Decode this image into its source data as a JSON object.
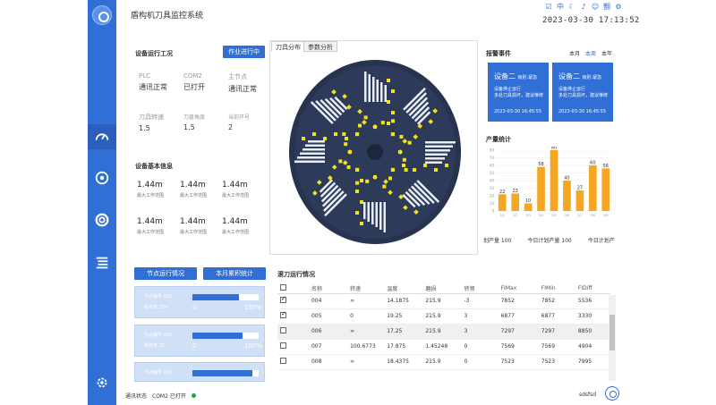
{
  "app": {
    "title": "盾构机刀具监控系统",
    "datetime": "2023-03-30  17:13:52",
    "user": "sdsfsd"
  },
  "topbar": {
    "icons": [
      "checkbox-icon",
      "lang-icon",
      "moon-icon",
      "notes-icon",
      "smiley-icon",
      "tree-icon",
      "gear-icon"
    ],
    "glyphs": [
      "☑",
      "中",
      "☾",
      "♪",
      "☺",
      "䎖",
      "⚙"
    ]
  },
  "sidebar": {
    "items": [
      "dashboard-icon",
      "cutter-icon",
      "lifebuoy-icon",
      "menu-icon",
      "settings-icon"
    ]
  },
  "run_status": {
    "title": "设备运行工况",
    "button": "作业进行中",
    "params": [
      {
        "label": "PLC",
        "value": "通讯正常"
      },
      {
        "label": "COM2",
        "value": "已打开"
      },
      {
        "label": "主节点",
        "value": "通讯正常"
      },
      {
        "label": "刀具转速",
        "value": "1.5"
      },
      {
        "label": "刀盘角度",
        "value": "1.5"
      },
      {
        "label": "当前环号",
        "value": "2"
      }
    ]
  },
  "basic_info": {
    "title": "设备基本信息",
    "items": [
      {
        "value": "1.44m",
        "label": "最大工作范围"
      },
      {
        "value": "1.44m",
        "label": "最大工作范围"
      },
      {
        "value": "1.44m",
        "label": "最大工作范围"
      },
      {
        "value": "1.44m",
        "label": "最大工作范围"
      },
      {
        "value": "1.44m",
        "label": "最大工作范围"
      },
      {
        "value": "1.44m",
        "label": "最大工作范围"
      }
    ]
  },
  "node_panel": {
    "button1": "节点运行情况",
    "button2": "本月累积统计",
    "cards": [
      {
        "l1": "节点编号  001",
        "l2": "损坏率  224",
        "fill": 0.7,
        "min": "0",
        "max": "100%"
      },
      {
        "l1": "节点编号  002",
        "l2": "损坏率  22",
        "fill": 0.75,
        "min": "0",
        "max": "100%"
      },
      {
        "l1": "节点编号  003",
        "l2": "",
        "fill": 0.9,
        "min": "0",
        "max": "100%"
      }
    ]
  },
  "cutter": {
    "tabs": [
      "刀具分布",
      "参数分析"
    ]
  },
  "events": {
    "title": "报警事件",
    "tabs": [
      "本月",
      "本周",
      "本年"
    ],
    "active_tab": "本周",
    "cards": [
      {
        "title": "设备二",
        "sub": "级别:紧急",
        "desc1": "设备停止运行",
        "desc2": "多处刀具损坏，建议维修",
        "time": "2023-03-30 16:45:55"
      },
      {
        "title": "设备二",
        "sub": "级别:紧急",
        "desc1": "设备停止运行",
        "desc2": "多处刀具损坏，建议维修",
        "time": "2023-03-30 16:45:55"
      }
    ]
  },
  "output": {
    "title": "产量统计",
    "stats": [
      "划产量 100",
      "今日计划产量 100",
      "今日计划产"
    ]
  },
  "chart_data": {
    "type": "bar",
    "title": "产量统计",
    "categories": [
      "3/1",
      "3/2",
      "3/3",
      "3/4",
      "3/5",
      "3/6",
      "3/7",
      "3/8",
      "3/9"
    ],
    "values": [
      22,
      23,
      10,
      58,
      80,
      40,
      27,
      60,
      56
    ],
    "ylim": [
      0,
      80
    ],
    "yticks": [
      0,
      10,
      20,
      30,
      40,
      50,
      60,
      70,
      80
    ],
    "color": "#f5a623"
  },
  "table": {
    "title": "滚刀运行情况",
    "columns": [
      "",
      "名称",
      "转速",
      "温度",
      "磨损",
      "转频",
      "FIMax",
      "FIMin",
      "FIDiff"
    ],
    "rows": [
      {
        "checked": true,
        "cells": [
          "004",
          "∞",
          "14.1875",
          "215.9",
          "-3",
          "7852",
          "7852",
          "5536"
        ]
      },
      {
        "checked": true,
        "cells": [
          "005",
          "0",
          "19.25",
          "215.9",
          "3",
          "6877",
          "6877",
          "3330"
        ]
      },
      {
        "checked": false,
        "cells": [
          "006",
          "∞",
          "17.25",
          "215.9",
          "3",
          "7297",
          "7297",
          "8850"
        ]
      },
      {
        "checked": false,
        "cells": [
          "007",
          "100.6773",
          "17.875",
          "1.45248",
          "0",
          "7569",
          "7569",
          "4904"
        ]
      },
      {
        "checked": false,
        "cells": [
          "008",
          "∞",
          "18.4375",
          "215.9",
          "0",
          "7523",
          "7523",
          "7995"
        ]
      }
    ]
  },
  "status": {
    "label": "通讯状态",
    "value": "COM2 已打开"
  }
}
